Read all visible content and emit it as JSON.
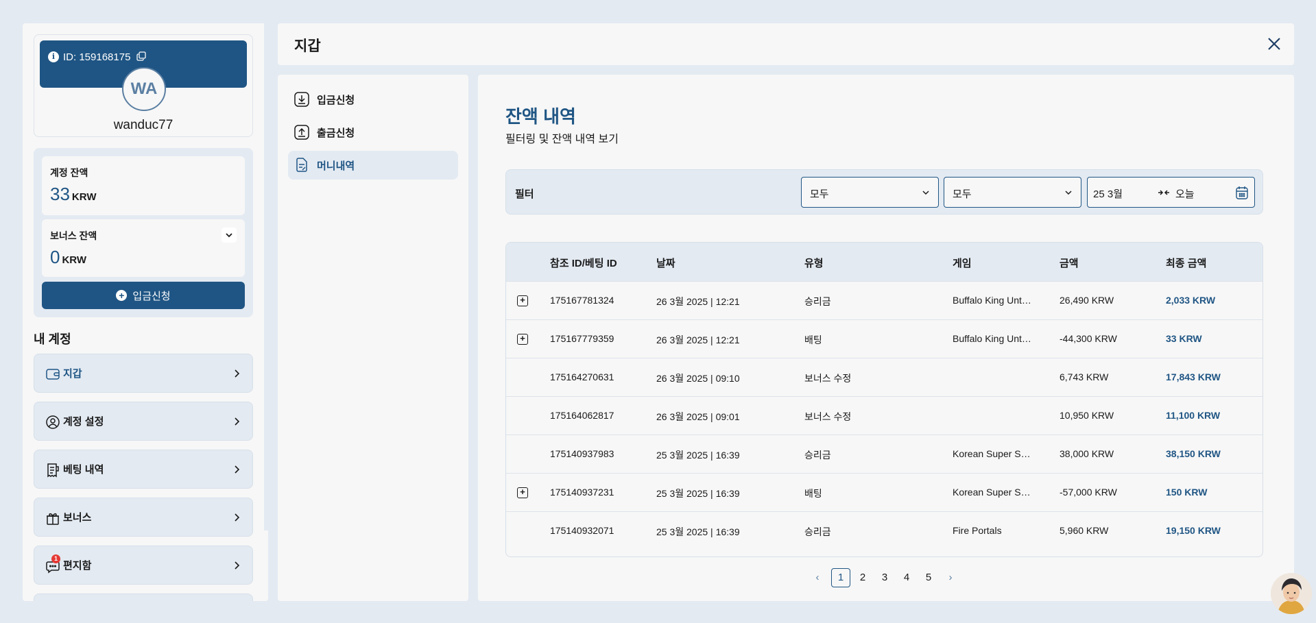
{
  "profile": {
    "id_text": "ID: 159168175",
    "avatar_initials": "WA",
    "username": "wanduc77"
  },
  "balances": {
    "account_label": "계정 잔액",
    "account_value": "33",
    "account_currency": "KRW",
    "bonus_label": "보너스 잔액",
    "bonus_value": "0",
    "bonus_currency": "KRW",
    "deposit_button": "입금신청"
  },
  "my_account": {
    "heading": "내 계정",
    "items": [
      {
        "label": "지갑",
        "icon": "wallet-icon",
        "active": true
      },
      {
        "label": "계정 설정",
        "icon": "user-settings-icon"
      },
      {
        "label": "베팅 내역",
        "icon": "receipt-icon"
      },
      {
        "label": "보너스",
        "icon": "gift-icon"
      },
      {
        "label": "편지함",
        "icon": "message-icon",
        "badge": "1"
      }
    ]
  },
  "header": {
    "title": "지갑"
  },
  "wallet_nav": {
    "items": [
      {
        "label": "입금신청",
        "icon": "download-icon"
      },
      {
        "label": "출금신청",
        "icon": "upload-icon"
      },
      {
        "label": "머니내역",
        "icon": "document-icon",
        "active": true
      }
    ]
  },
  "main": {
    "title": "잔액 내역",
    "subtitle": "필터링 및 잔액 내역 보기",
    "filter": {
      "label": "필터",
      "select1": "모두",
      "select2": "모두",
      "date_from": "25 3월",
      "date_to": "오늘"
    },
    "table": {
      "headers": [
        "참조 ID/베팅 ID",
        "날짜",
        "유형",
        "게임",
        "금액",
        "최종 금액"
      ],
      "rows": [
        {
          "expand": true,
          "id": "175167781324",
          "date": "26 3월 2025 | 12:21",
          "type": "승리금",
          "game": "Buffalo King Unt…",
          "amount": "26,490 KRW",
          "final": "2,033 KRW"
        },
        {
          "expand": true,
          "id": "175167779359",
          "date": "26 3월 2025 | 12:21",
          "type": "배팅",
          "game": "Buffalo King Unt…",
          "amount": "-44,300 KRW",
          "final": "33 KRW"
        },
        {
          "expand": false,
          "id": "175164270631",
          "date": "26 3월 2025 | 09:10",
          "type": "보너스 수정",
          "game": "",
          "amount": "6,743 KRW",
          "final": "17,843 KRW"
        },
        {
          "expand": false,
          "id": "175164062817",
          "date": "26 3월 2025 | 09:01",
          "type": "보너스 수정",
          "game": "",
          "amount": "10,950 KRW",
          "final": "11,100 KRW"
        },
        {
          "expand": false,
          "id": "175140937983",
          "date": "25 3월 2025 | 16:39",
          "type": "승리금",
          "game": "Korean Super S…",
          "amount": "38,000 KRW",
          "final": "38,150 KRW"
        },
        {
          "expand": true,
          "id": "175140937231",
          "date": "25 3월 2025 | 16:39",
          "type": "배팅",
          "game": "Korean Super S…",
          "amount": "-57,000 KRW",
          "final": "150 KRW"
        },
        {
          "expand": false,
          "id": "175140932071",
          "date": "25 3월 2025 | 16:39",
          "type": "승리금",
          "game": "Fire Portals",
          "amount": "5,960 KRW",
          "final": "19,150 KRW"
        }
      ]
    },
    "pagination": {
      "pages": [
        "1",
        "2",
        "3",
        "4",
        "5"
      ],
      "current": "1",
      "prev": "‹",
      "next": "›"
    }
  },
  "colors": {
    "primary": "#1f5584",
    "background": "#e3eaf2",
    "panel": "#f7f7f7",
    "badge": "#e53935"
  }
}
